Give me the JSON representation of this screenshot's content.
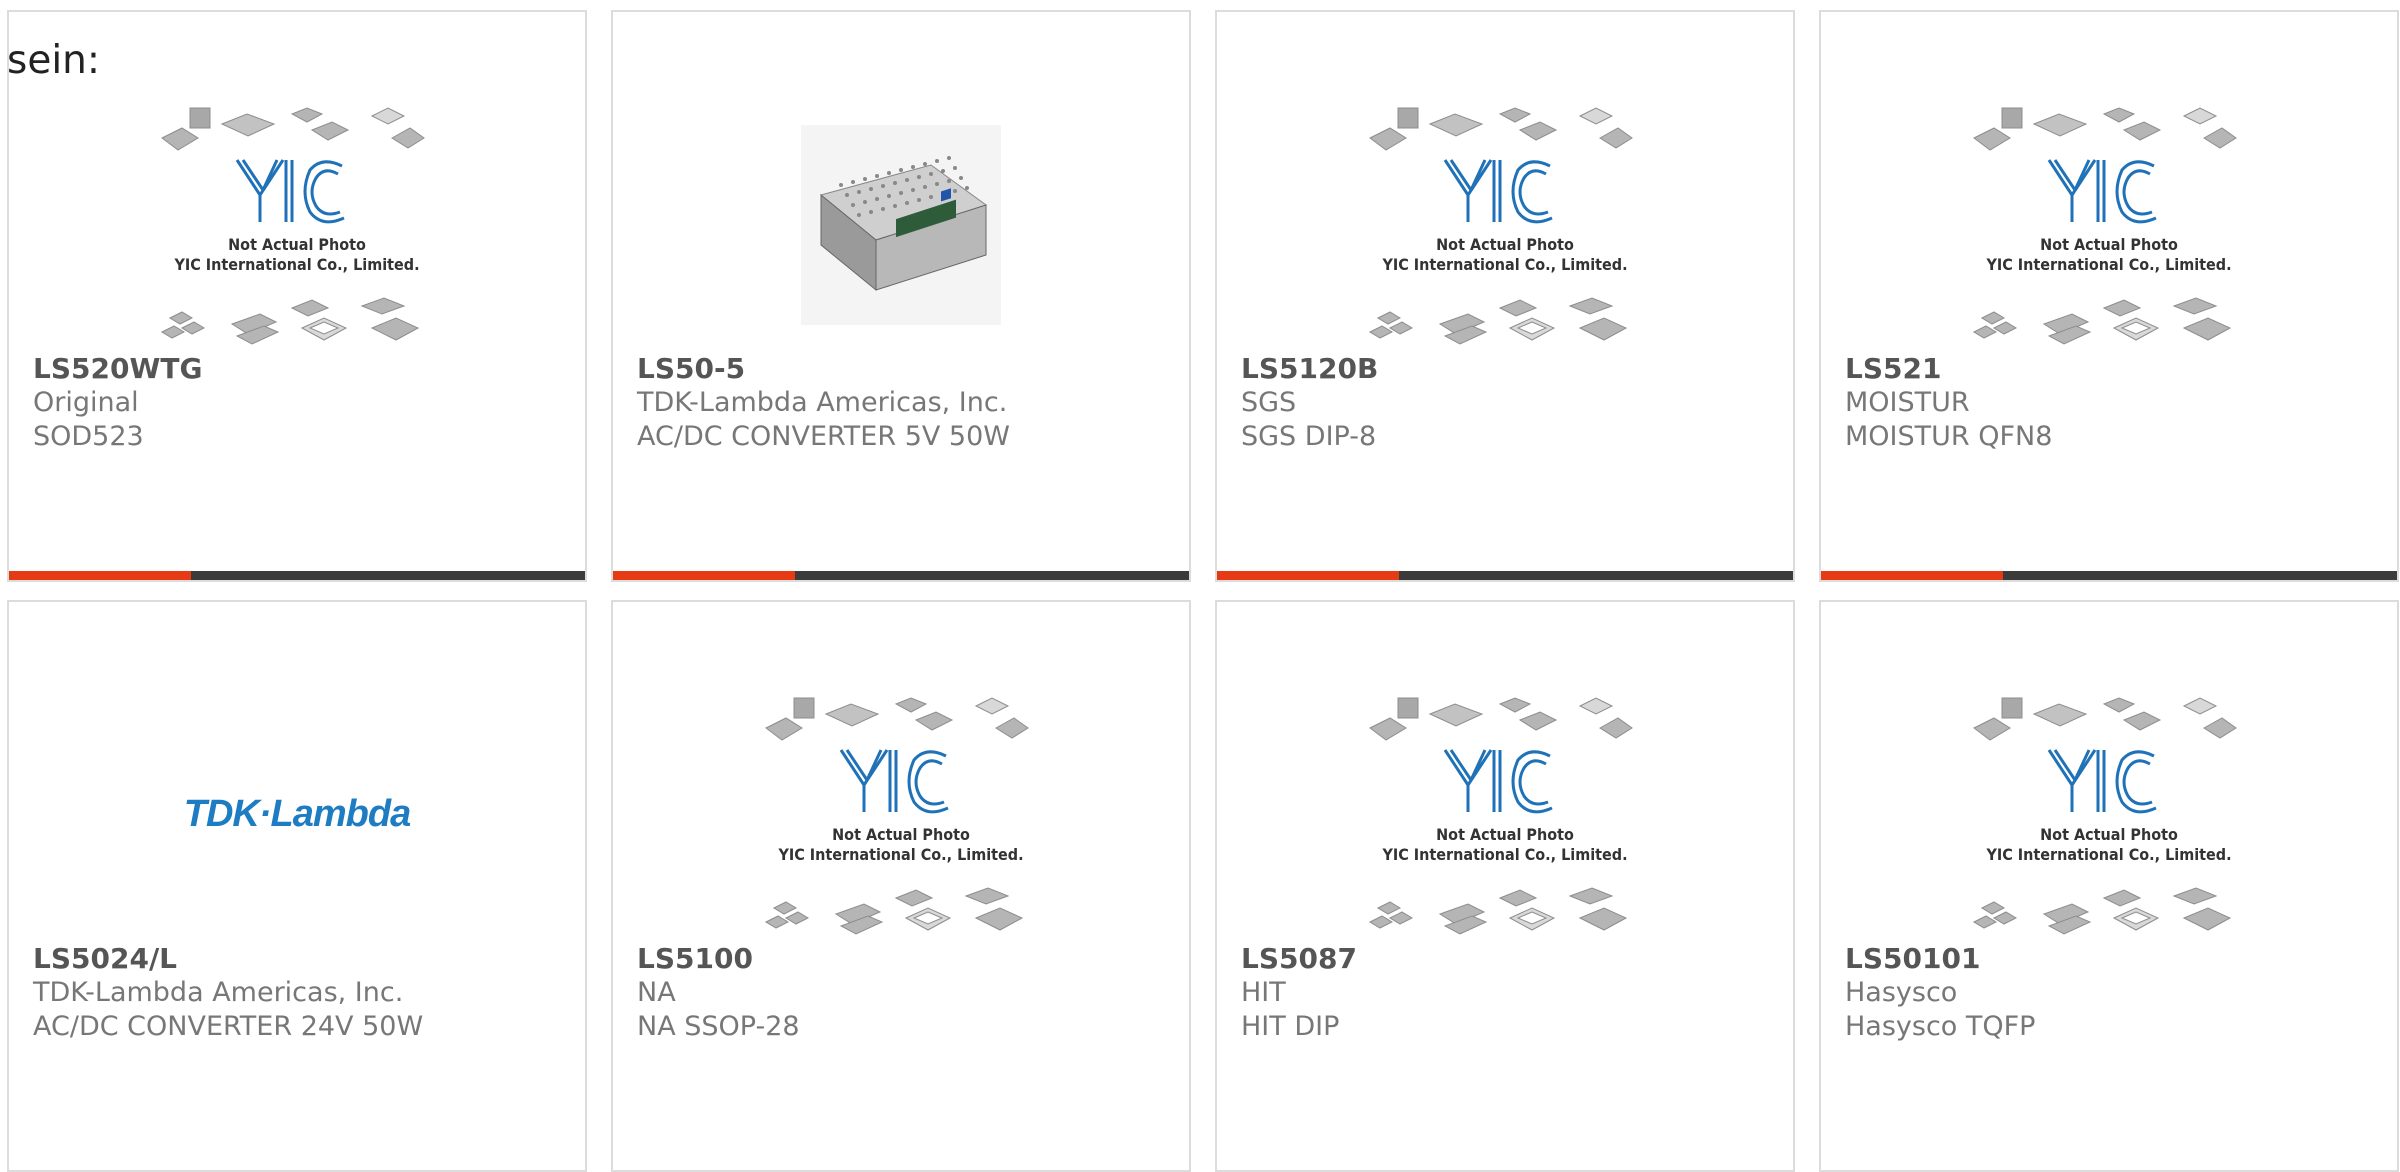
{
  "page": {
    "lead_text": "sein:"
  },
  "placeholder": {
    "caption_line1": "Not Actual Photo",
    "caption_line2": "YIC International Co., Limited.",
    "logo_text": "YIC"
  },
  "colors": {
    "accent": "#e63a14",
    "bar": "#3b3b3b",
    "border": "#dcdcdc",
    "logo_blue": "#1d7cc2"
  },
  "products": [
    {
      "part": "LS520WTG",
      "manufacturer": "Original",
      "description": "SOD523",
      "image": "placeholder",
      "has_bar": true
    },
    {
      "part": "LS50-5",
      "manufacturer": "TDK-Lambda Americas, Inc.",
      "description": "AC/DC CONVERTER 5V 50W",
      "image": "power-supply-photo",
      "has_bar": true
    },
    {
      "part": "LS5120B",
      "manufacturer": "SGS",
      "description": "SGS DIP-8",
      "image": "placeholder",
      "has_bar": true
    },
    {
      "part": "LS521",
      "manufacturer": "MOISTUR",
      "description": "MOISTUR QFN8",
      "image": "placeholder",
      "has_bar": true
    },
    {
      "part": "LS5024/L",
      "manufacturer": "TDK-Lambda Americas, Inc.",
      "description": "AC/DC CONVERTER 24V 50W",
      "image": "tdk-lambda-logo",
      "logo_text": "TDK·Lambda",
      "has_bar": false
    },
    {
      "part": "LS5100",
      "manufacturer": "NA",
      "description": "NA SSOP-28",
      "image": "placeholder",
      "has_bar": false
    },
    {
      "part": "LS5087",
      "manufacturer": "HIT",
      "description": "HIT DIP",
      "image": "placeholder",
      "has_bar": false
    },
    {
      "part": "LS50101",
      "manufacturer": "Hasysco",
      "description": "Hasysco TQFP",
      "image": "placeholder",
      "has_bar": false
    }
  ]
}
